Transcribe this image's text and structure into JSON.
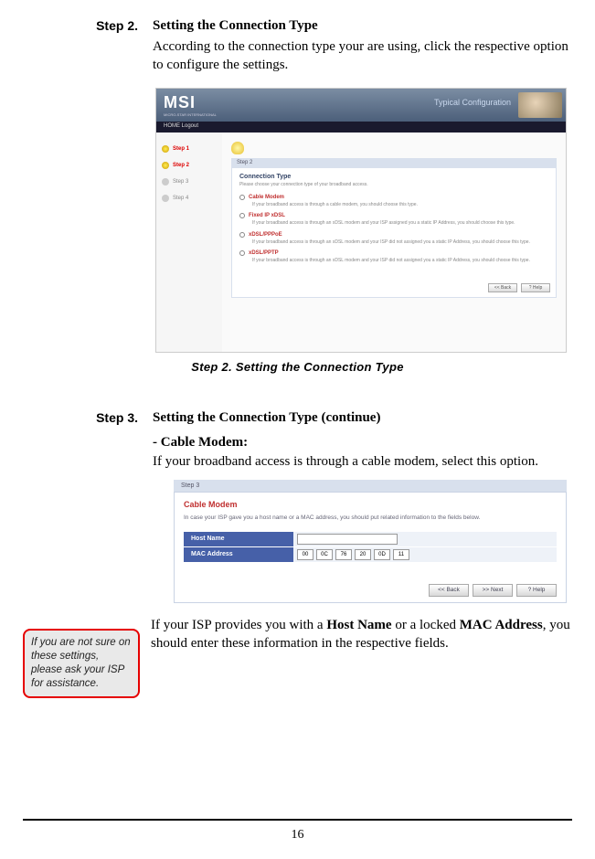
{
  "step2": {
    "label": "Step 2.",
    "title": "Setting the Connection Type",
    "body": "According to the connection type your are using, click the respective option to configure the settings.",
    "caption": "Step 2. Setting the Connection Type"
  },
  "step3": {
    "label": "Step 3.",
    "title": "Setting the Connection Type (continue)",
    "subhead": "- Cable Modem:",
    "body": "If your broadband access is through a cable modem, select this option.",
    "finalText": "If your ISP provides you with a Host Name or a locked MAC Address, you should enter these information in the respective fields."
  },
  "ss1": {
    "logo": "MSI",
    "logoSub": "MICRO-STAR INTERNATIONAL",
    "bannerRight": "Typical Configuration",
    "toolbar": "HOME   Logout",
    "sidebarSteps": [
      "Step 1",
      "Step 2",
      "Step 3",
      "Step 4"
    ],
    "tab": "Step 2",
    "panelTitle": "Connection Type",
    "panelSub": "Please choose your connection type of your broadband access.",
    "options": [
      {
        "label": "Cable Modem",
        "desc": "If your broadband access is through a cable modem, you should choose this type."
      },
      {
        "label": "Fixed IP xDSL",
        "desc": "If your broadband access is through an xDSL modem and your ISP assigned you a static IP Address, you should choose this type."
      },
      {
        "label": "xDSL/PPPoE",
        "desc": "If your broadband access is through an xDSL modem and your ISP did not assigned you a static IP Address, you should choose this type."
      },
      {
        "label": "xDSL/PPTP",
        "desc": "If your broadband access is through an xDSL modem and your ISP did not assigned you a static IP Address, you should choose this type."
      }
    ],
    "btnBack": "<< Back",
    "btnHelp": "? Help"
  },
  "ss2": {
    "tab": "Step 3",
    "title": "Cable Modem",
    "desc": "In case your ISP gave you a host name or a MAC address, you should put related information to the fields below.",
    "hostLabel": "Host Name",
    "hostValue": "",
    "macLabel": "MAC Address",
    "mac": [
      "00",
      "0C",
      "76",
      "20",
      "0D",
      "11"
    ],
    "btnBack": "<< Back",
    "btnNext": ">> Next",
    "btnHelp": "? Help"
  },
  "tip": "If you are not sure on these settings, please ask your ISP for assistance.",
  "pageNumber": "16"
}
